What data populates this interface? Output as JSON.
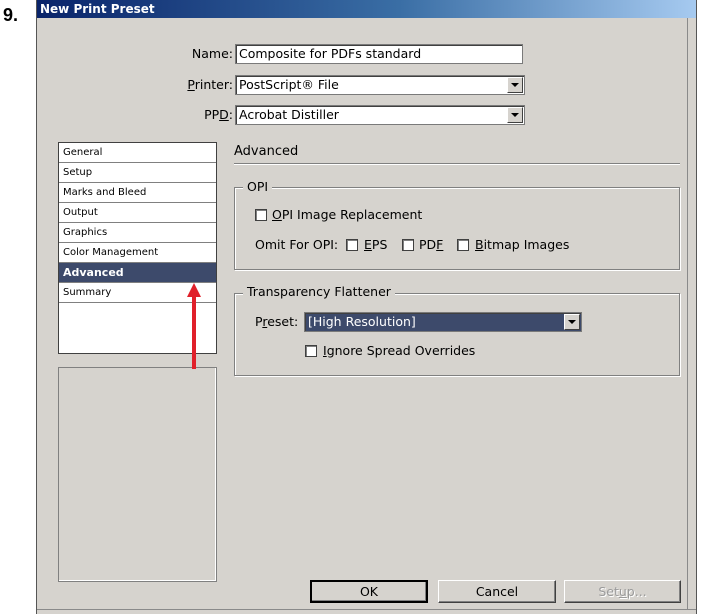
{
  "step_number": "9.",
  "dialog": {
    "title": "New Print Preset",
    "name_label": "Name:",
    "name_value": "Composite for PDFs standard",
    "printer_label_pre": "",
    "printer_label_key": "P",
    "printer_label_post": "rinter:",
    "printer_value": "PostScript® File",
    "ppd_label_pre": "PP",
    "ppd_label_key": "D",
    "ppd_label_post": ":",
    "ppd_value": "Acrobat Distiller"
  },
  "sidebar": {
    "items": [
      {
        "label": "General"
      },
      {
        "label": "Setup"
      },
      {
        "label": "Marks and Bleed"
      },
      {
        "label": "Output"
      },
      {
        "label": "Graphics"
      },
      {
        "label": "Color Management"
      },
      {
        "label": "Advanced"
      },
      {
        "label": "Summary"
      }
    ],
    "selected_index": 6
  },
  "panel": {
    "title": "Advanced",
    "opi": {
      "group_label": "OPI",
      "replacement_key": "O",
      "replacement_rest": "PI Image Replacement",
      "replacement_checked": false,
      "omit_label": "Omit For OPI:",
      "eps_key": "E",
      "eps_rest": "PS",
      "eps_checked": false,
      "pdf_pre": "PD",
      "pdf_key": "F",
      "pdf_checked": false,
      "bitmap_key": "B",
      "bitmap_rest": "itmap Images",
      "bitmap_checked": false
    },
    "flattener": {
      "group_label": "Transparency Flattener",
      "preset_pre": "P",
      "preset_key": "r",
      "preset_post": "eset:",
      "preset_value": "[High Resolution]",
      "ignore_key": "I",
      "ignore_rest": "gnore Spread Overrides",
      "ignore_checked": false
    }
  },
  "buttons": {
    "ok": "OK",
    "cancel": "Cancel",
    "setup_pre": "Set",
    "setup_key": "u",
    "setup_post": "p..."
  },
  "colors": {
    "dialog_bg": "#d6d3ce",
    "title_bar": "#0a246a",
    "selection": "#3d4a6b",
    "arrow": "#e0202a"
  }
}
